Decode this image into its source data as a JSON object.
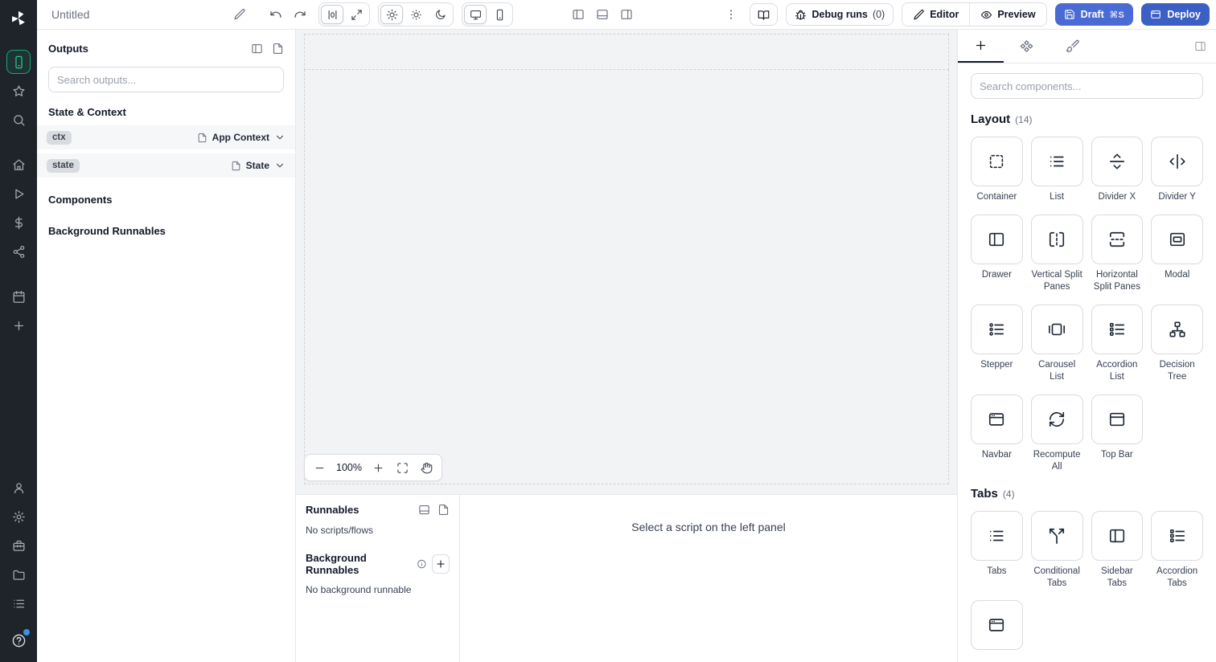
{
  "colors": {
    "primary": "#4a6bd4",
    "primary2": "#3c5fc6",
    "green": "#17a673"
  },
  "rail": {
    "active": "smartphone",
    "top": [
      "smartphone",
      "star",
      "search"
    ],
    "mid": [
      "home",
      "play",
      "dollar",
      "workflow"
    ],
    "mid2": [
      "calendar",
      "plus"
    ],
    "bottom": [
      "user",
      "gear",
      "toolbox",
      "folder",
      "list"
    ]
  },
  "topbar": {
    "title": "Untitled",
    "debug_label": "Debug runs",
    "debug_count": "(0)",
    "editor_label": "Editor",
    "preview_label": "Preview",
    "draft_label": "Draft",
    "draft_shortcut": "⌘S",
    "deploy_label": "Deploy"
  },
  "outputs": {
    "title": "Outputs",
    "search_placeholder": "Search outputs...",
    "state_heading": "State & Context",
    "rows": [
      {
        "badge": "ctx",
        "type": "App Context"
      },
      {
        "badge": "state",
        "type": "State"
      }
    ],
    "components_heading": "Components",
    "background_heading": "Background Runnables"
  },
  "canvas": {
    "zoom": "100%"
  },
  "runnables": {
    "title": "Runnables",
    "empty": "No scripts/flows",
    "background_title": "Background Runnables",
    "background_empty": "No background runnable"
  },
  "script_panel": {
    "message": "Select a script on the left panel"
  },
  "components_panel": {
    "search_placeholder": "Search components...",
    "sections": [
      {
        "title": "Layout",
        "count": "(14)",
        "items": [
          {
            "label": "Container",
            "icon": "container"
          },
          {
            "label": "List",
            "icon": "list"
          },
          {
            "label": "Divider X",
            "icon": "divider-x"
          },
          {
            "label": "Divider Y",
            "icon": "divider-y"
          },
          {
            "label": "Drawer",
            "icon": "panel-left"
          },
          {
            "label": "Vertical Split Panes",
            "icon": "vsplit"
          },
          {
            "label": "Horizontal Split Panes",
            "icon": "hsplit"
          },
          {
            "label": "Modal",
            "icon": "modal"
          },
          {
            "label": "Stepper",
            "icon": "stepper"
          },
          {
            "label": "Carousel List",
            "icon": "carousel"
          },
          {
            "label": "Accordion List",
            "icon": "accordion-list"
          },
          {
            "label": "Decision Tree",
            "icon": "decision-tree"
          },
          {
            "label": "Navbar",
            "icon": "window"
          },
          {
            "label": "Recompute All",
            "icon": "recompute"
          },
          {
            "label": "Top Bar",
            "icon": "topbar-panel"
          }
        ]
      },
      {
        "title": "Tabs",
        "count": "(4)",
        "items": [
          {
            "label": "Tabs",
            "icon": "list"
          },
          {
            "label": "Conditional Tabs",
            "icon": "split"
          },
          {
            "label": "Sidebar Tabs",
            "icon": "panel-left"
          },
          {
            "label": "Accordion Tabs",
            "icon": "accordion-list"
          },
          {
            "label": "",
            "icon": "window"
          }
        ]
      }
    ]
  }
}
